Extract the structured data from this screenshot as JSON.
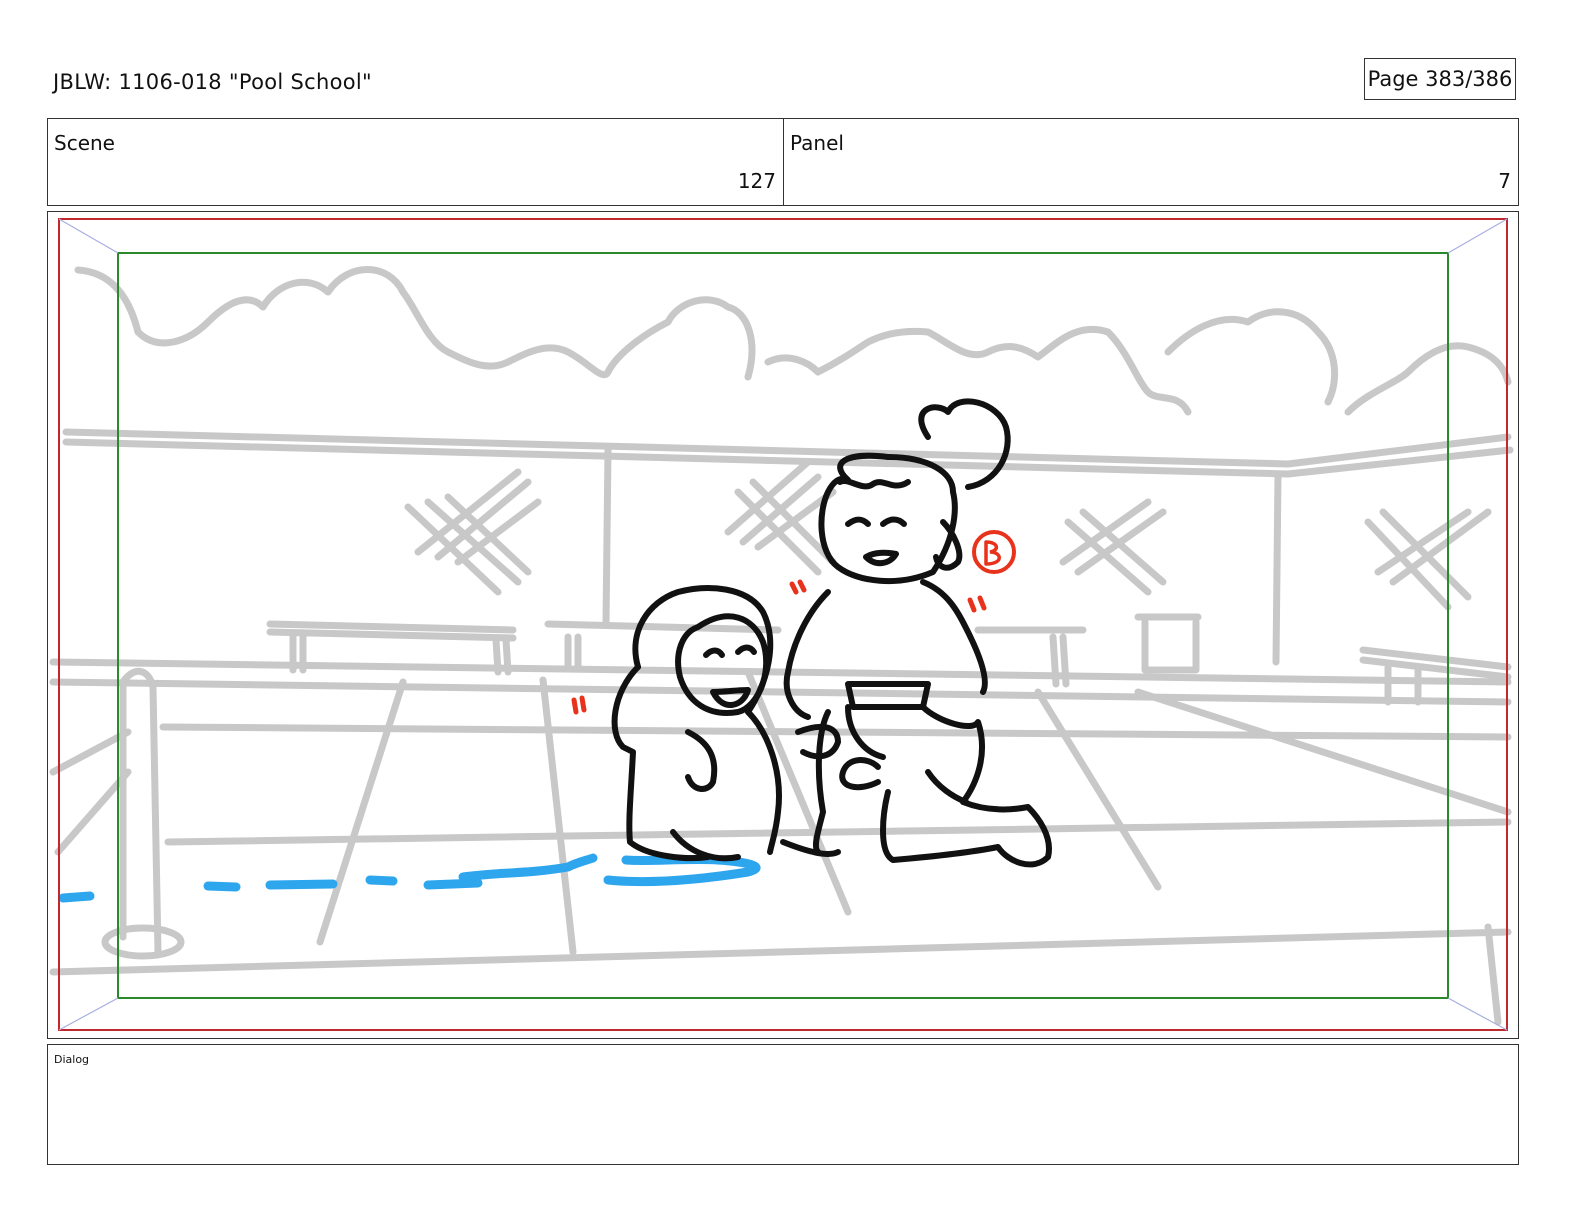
{
  "header": {
    "title": "JBLW: 1106-018 \"Pool School\"",
    "page": "Page 383/386"
  },
  "info": {
    "scene_label": "Scene",
    "scene_value": "127",
    "panel_label": "Panel",
    "panel_value": "7"
  },
  "dialog": {
    "label": "Dialog"
  },
  "colors": {
    "sketch_gray": "#c8c8c8",
    "ink": "#111111",
    "water": "#2ea6ee",
    "annotation": "#e8321c",
    "action_safe": "#c0282d",
    "title_safe": "#2a8a2a"
  }
}
